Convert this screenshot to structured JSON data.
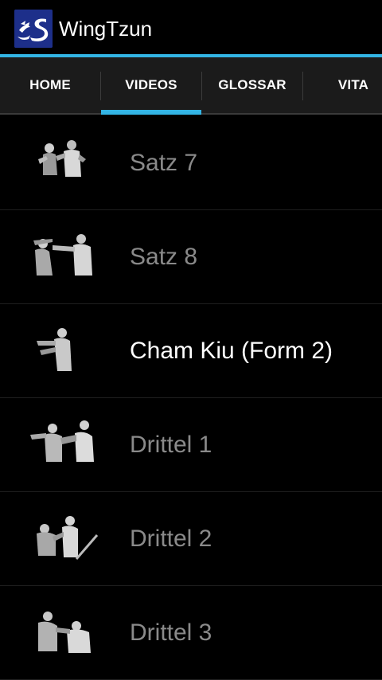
{
  "app": {
    "title": "WingTzun",
    "icon": "wingtzun-dragon-logo",
    "accent_color": "#33b5e5"
  },
  "tabs": [
    {
      "label": "HOME",
      "selected": false
    },
    {
      "label": "VIDEOS",
      "selected": true
    },
    {
      "label": "GLOSSAR",
      "selected": false
    },
    {
      "label": "VITA",
      "selected": false
    }
  ],
  "videos": [
    {
      "title": "Satz 7",
      "thumbnail": "fighters-thumbnail",
      "highlighted": false
    },
    {
      "title": "Satz 8",
      "thumbnail": "fighters-thumbnail",
      "highlighted": false
    },
    {
      "title": "Cham Kiu (Form 2)",
      "thumbnail": "fighter-thumbnail",
      "highlighted": true
    },
    {
      "title": "Drittel 1",
      "thumbnail": "fighters-thumbnail",
      "highlighted": false
    },
    {
      "title": "Drittel 2",
      "thumbnail": "fighters-stick-thumbnail",
      "highlighted": false
    },
    {
      "title": "Drittel 3",
      "thumbnail": "fighters-thumbnail",
      "highlighted": false
    }
  ]
}
